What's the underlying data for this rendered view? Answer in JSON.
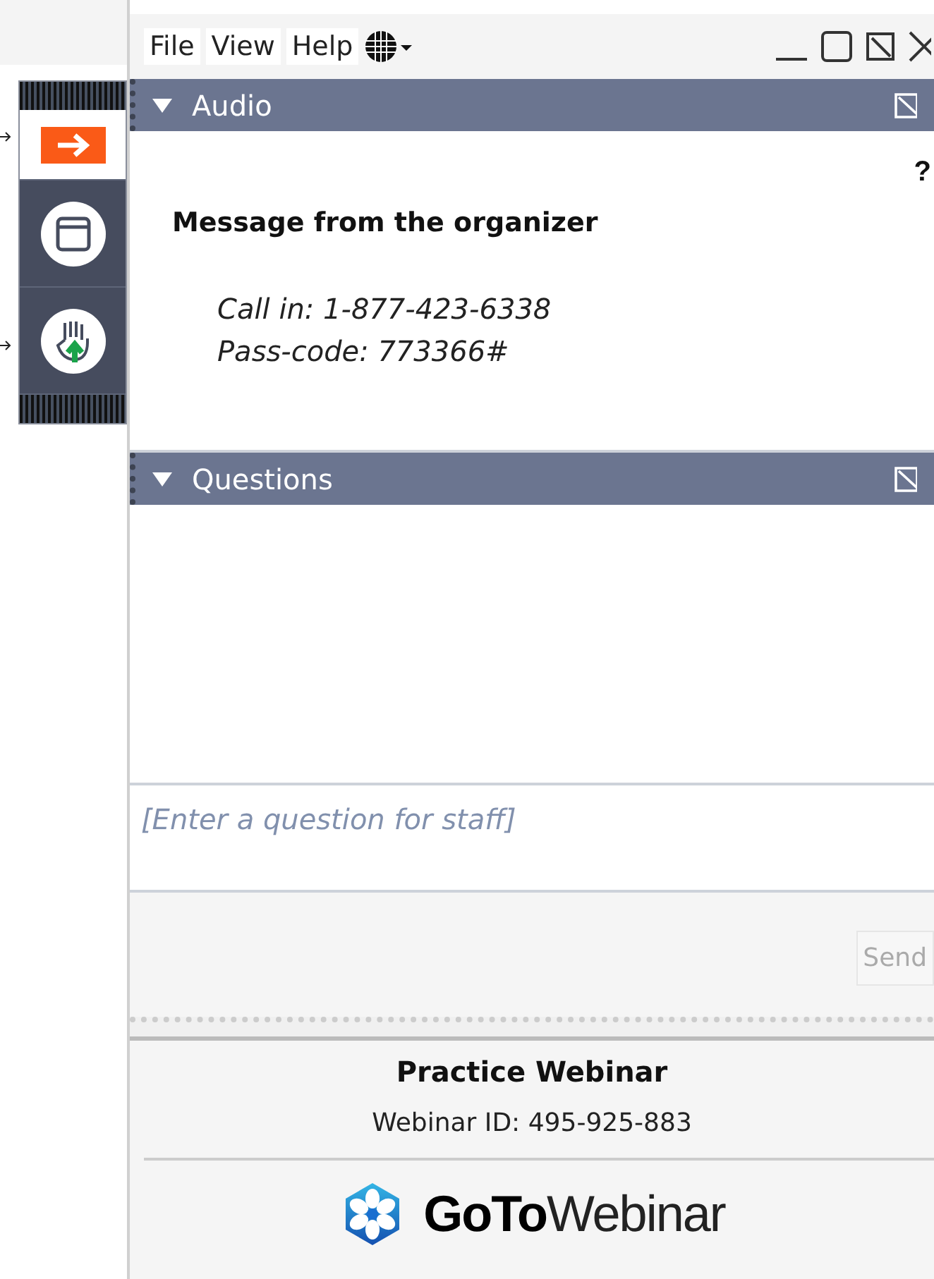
{
  "menu": [
    "File",
    "View",
    "Help"
  ],
  "rail": [
    {
      "kind": "arrow",
      "selected": true
    },
    {
      "kind": "window",
      "selected": false
    },
    {
      "kind": "hand",
      "selected": false
    }
  ],
  "audio": {
    "title": "Audio",
    "expanded": true,
    "help": "?",
    "heading": "Message from the organizer",
    "lines": [
      "Call in: 1-877-423-6338",
      "Pass-code: 773366#"
    ]
  },
  "questions": {
    "title": "Questions",
    "expanded": true,
    "placeholder": "[Enter a question for staff]",
    "send": "Send"
  },
  "footer": {
    "title": "Practice Webinar",
    "id": "Webinar ID: 495-925-883",
    "logo": "**GoTo**Webinar"
  }
}
